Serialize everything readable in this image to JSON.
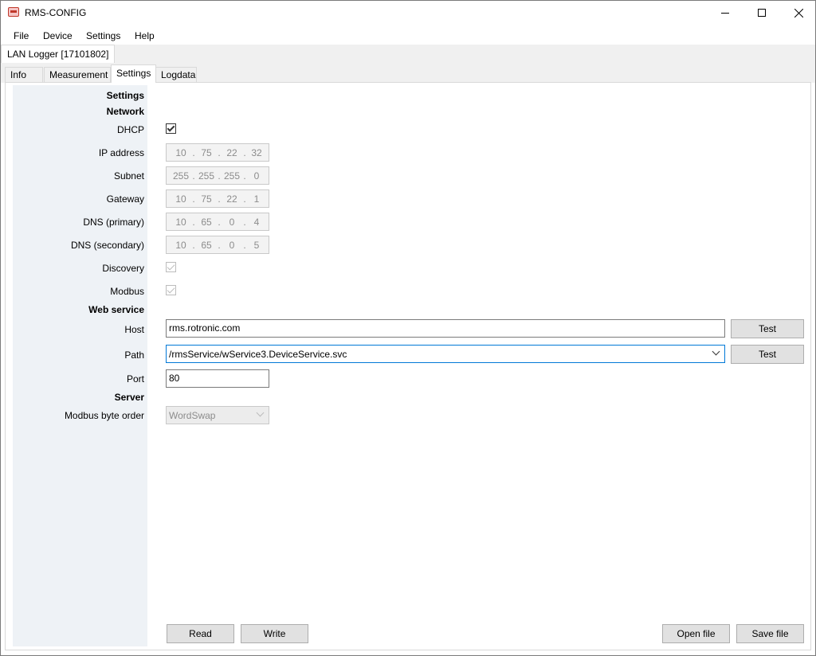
{
  "window": {
    "title": "RMS-CONFIG"
  },
  "menu": {
    "items": [
      "File",
      "Device",
      "Settings",
      "Help"
    ]
  },
  "device_tab": {
    "label": "LAN Logger [17101802]"
  },
  "tabs": [
    {
      "label": "Info",
      "active": false
    },
    {
      "label": "Measurement",
      "active": false
    },
    {
      "label": "Settings",
      "active": true
    },
    {
      "label": "Logdata",
      "active": false
    }
  ],
  "form": {
    "section_settings": "Settings",
    "section_network": "Network",
    "dhcp_label": "DHCP",
    "dhcp_checked": true,
    "ip_label": "IP address",
    "ip": [
      "10",
      "75",
      "22",
      "32"
    ],
    "subnet_label": "Subnet",
    "subnet": [
      "255",
      "255",
      "255",
      "0"
    ],
    "gateway_label": "Gateway",
    "gateway": [
      "10",
      "75",
      "22",
      "1"
    ],
    "dns1_label": "DNS (primary)",
    "dns1": [
      "10",
      "65",
      "0",
      "4"
    ],
    "dns2_label": "DNS (secondary)",
    "dns2": [
      "10",
      "65",
      "0",
      "5"
    ],
    "discovery_label": "Discovery",
    "discovery_checked": true,
    "modbus_label": "Modbus",
    "modbus_checked": true,
    "section_web": "Web service",
    "host_label": "Host",
    "host_value": "rms.rotronic.com",
    "path_label": "Path",
    "path_value": "/rmsService/wService3.DeviceService.svc",
    "port_label": "Port",
    "port_value": "80",
    "section_server": "Server",
    "byte_order_label": "Modbus byte order",
    "byte_order_value": "WordSwap",
    "test_label": "Test"
  },
  "footer": {
    "read_label": "Read",
    "write_label": "Write",
    "open_label": "Open file",
    "save_label": "Save file"
  },
  "icons": {
    "app": "logger-app-icon",
    "minimize": "minimize-icon",
    "maximize": "maximize-icon",
    "close": "close-icon"
  }
}
